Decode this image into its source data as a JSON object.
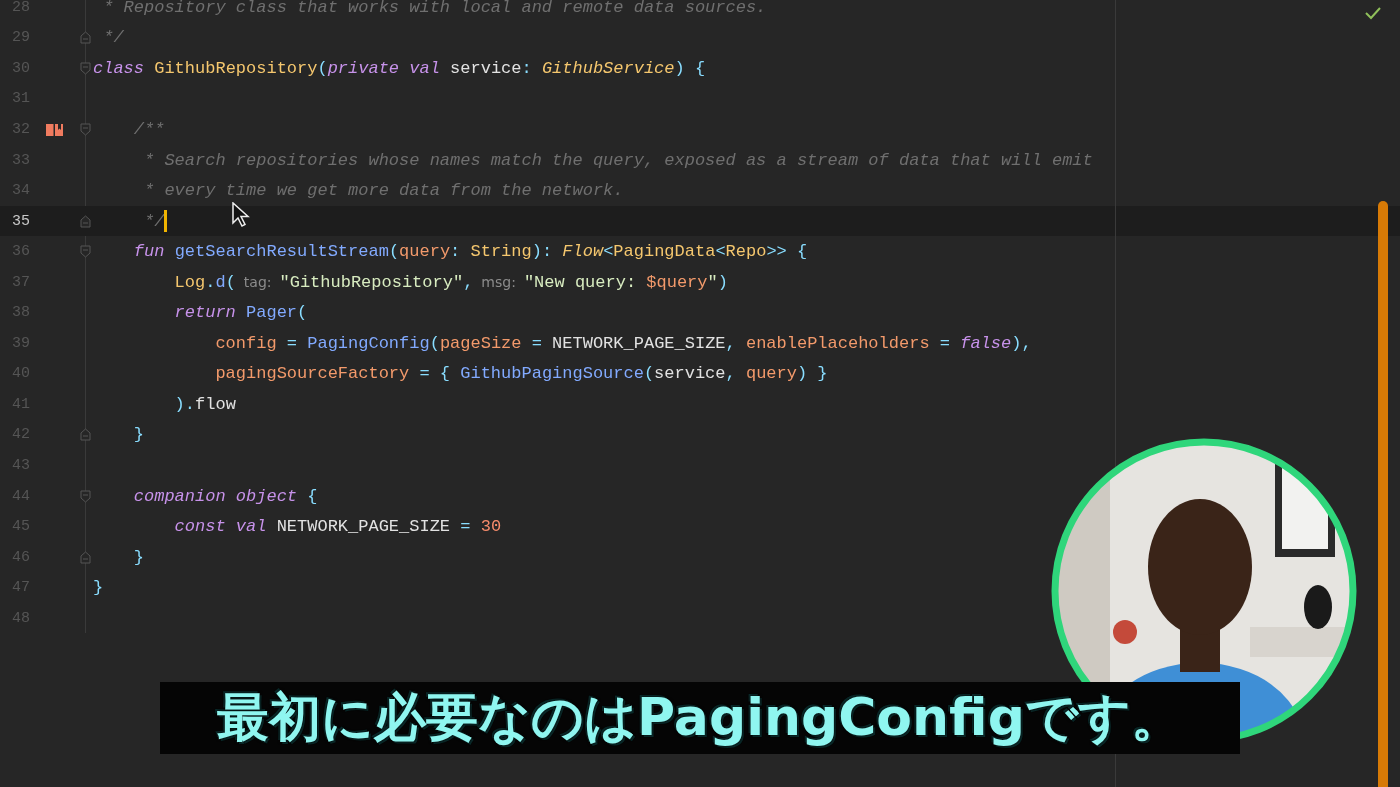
{
  "editor": {
    "lines": [
      {
        "number": "28",
        "current": false,
        "bookmarked": false,
        "fold_open": false,
        "fold_close": false,
        "caret": false,
        "tokens": [
          {
            "kind": "comment",
            "text": " * Repository class that works with local and remote data sources."
          }
        ]
      },
      {
        "number": "29",
        "current": false,
        "bookmarked": false,
        "fold_open": false,
        "fold_close": true,
        "caret": false,
        "tokens": [
          {
            "kind": "comment",
            "text": " */"
          }
        ]
      },
      {
        "number": "30",
        "current": false,
        "bookmarked": false,
        "fold_open": true,
        "fold_close": false,
        "caret": false,
        "tokens": [
          {
            "kind": "kw",
            "text": "class "
          },
          {
            "kind": "type",
            "text": "GithubRepository"
          },
          {
            "kind": "punc",
            "text": "("
          },
          {
            "kind": "kw",
            "text": "private val"
          },
          {
            "kind": "plain",
            "text": " service"
          },
          {
            "kind": "punc",
            "text": ": "
          },
          {
            "kind": "typeit",
            "text": "GithubService"
          },
          {
            "kind": "punc",
            "text": ") {"
          }
        ]
      },
      {
        "number": "31",
        "current": false,
        "bookmarked": false,
        "fold_open": false,
        "fold_close": false,
        "caret": false
      },
      {
        "number": "32",
        "current": false,
        "bookmarked": true,
        "fold_open": true,
        "fold_close": false,
        "caret": false,
        "tokens": [
          {
            "kind": "comment",
            "text": "    /**"
          }
        ]
      },
      {
        "number": "33",
        "current": false,
        "bookmarked": false,
        "fold_open": false,
        "fold_close": false,
        "caret": false,
        "tokens": [
          {
            "kind": "comment",
            "text": "     * Search repositories whose names match the query, exposed as a stream of data that will emit"
          }
        ]
      },
      {
        "number": "34",
        "current": false,
        "bookmarked": false,
        "fold_open": false,
        "fold_close": false,
        "caret": false,
        "tokens": [
          {
            "kind": "comment",
            "text": "     * every time we get more data from the network."
          }
        ]
      },
      {
        "number": "35",
        "current": true,
        "bookmarked": false,
        "fold_open": false,
        "fold_close": true,
        "caret": true,
        "tokens": [
          {
            "kind": "comment",
            "text": "     */"
          }
        ]
      },
      {
        "number": "36",
        "current": false,
        "bookmarked": false,
        "fold_open": true,
        "fold_close": false,
        "caret": false,
        "tokens": [
          {
            "kind": "kw",
            "text": "    fun "
          },
          {
            "kind": "fn",
            "text": "getSearchResultStream"
          },
          {
            "kind": "punc",
            "text": "("
          },
          {
            "kind": "param",
            "text": "query"
          },
          {
            "kind": "punc",
            "text": ": "
          },
          {
            "kind": "type",
            "text": "String"
          },
          {
            "kind": "punc",
            "text": "): "
          },
          {
            "kind": "typeit",
            "text": "Flow"
          },
          {
            "kind": "punc",
            "text": "<"
          },
          {
            "kind": "type",
            "text": "PagingData"
          },
          {
            "kind": "punc",
            "text": "<"
          },
          {
            "kind": "type",
            "text": "Repo"
          },
          {
            "kind": "punc",
            "text": ">> {"
          }
        ]
      },
      {
        "number": "37",
        "current": false,
        "bookmarked": false,
        "fold_open": false,
        "fold_close": false,
        "caret": false,
        "tokens": [
          {
            "kind": "type",
            "text": "        Log"
          },
          {
            "kind": "punc",
            "text": "."
          },
          {
            "kind": "fn",
            "text": "d"
          },
          {
            "kind": "punc",
            "text": "("
          },
          {
            "kind": "hint",
            "text": "tag:"
          },
          {
            "kind": "str",
            "text": "\"GithubRepository\""
          },
          {
            "kind": "punc",
            "text": ","
          },
          {
            "kind": "hint",
            "text": "msg:"
          },
          {
            "kind": "str",
            "text": "\"New query: "
          },
          {
            "kind": "param",
            "text": "$query"
          },
          {
            "kind": "str",
            "text": "\""
          },
          {
            "kind": "punc",
            "text": ")"
          }
        ]
      },
      {
        "number": "38",
        "current": false,
        "bookmarked": false,
        "fold_open": false,
        "fold_close": false,
        "caret": false,
        "tokens": [
          {
            "kind": "kw",
            "text": "        return "
          },
          {
            "kind": "fn",
            "text": "Pager"
          },
          {
            "kind": "punc",
            "text": "("
          }
        ]
      },
      {
        "number": "39",
        "current": false,
        "bookmarked": false,
        "fold_open": false,
        "fold_close": false,
        "caret": false,
        "tokens": [
          {
            "kind": "param",
            "text": "            config "
          },
          {
            "kind": "punc",
            "text": "= "
          },
          {
            "kind": "fn",
            "text": "PagingConfig"
          },
          {
            "kind": "punc",
            "text": "("
          },
          {
            "kind": "param",
            "text": "pageSize "
          },
          {
            "kind": "punc",
            "text": "= "
          },
          {
            "kind": "plain",
            "text": "NETWORK_PAGE_SIZE"
          },
          {
            "kind": "punc",
            "text": ", "
          },
          {
            "kind": "param",
            "text": "enablePlaceholders "
          },
          {
            "kind": "punc",
            "text": "= "
          },
          {
            "kind": "kw",
            "text": "false"
          },
          {
            "kind": "punc",
            "text": "),"
          }
        ]
      },
      {
        "number": "40",
        "current": false,
        "bookmarked": false,
        "fold_open": false,
        "fold_close": false,
        "caret": false,
        "tokens": [
          {
            "kind": "param",
            "text": "            pagingSourceFactory "
          },
          {
            "kind": "punc",
            "text": "= { "
          },
          {
            "kind": "fn",
            "text": "GithubPagingSource"
          },
          {
            "kind": "punc",
            "text": "("
          },
          {
            "kind": "plain",
            "text": "service"
          },
          {
            "kind": "punc",
            "text": ", "
          },
          {
            "kind": "param",
            "text": "query"
          },
          {
            "kind": "punc",
            "text": ") }"
          }
        ]
      },
      {
        "number": "41",
        "current": false,
        "bookmarked": false,
        "fold_open": false,
        "fold_close": false,
        "caret": false,
        "tokens": [
          {
            "kind": "punc",
            "text": "        )."
          },
          {
            "kind": "plain",
            "text": "flow"
          }
        ]
      },
      {
        "number": "42",
        "current": false,
        "bookmarked": false,
        "fold_open": false,
        "fold_close": true,
        "caret": false,
        "tokens": [
          {
            "kind": "punc",
            "text": "    }"
          }
        ]
      },
      {
        "number": "43",
        "current": false,
        "bookmarked": false,
        "fold_open": false,
        "fold_close": false,
        "caret": false
      },
      {
        "number": "44",
        "current": false,
        "bookmarked": false,
        "fold_open": true,
        "fold_close": false,
        "caret": false,
        "tokens": [
          {
            "kind": "kw",
            "text": "    companion object"
          },
          {
            "kind": "punc",
            "text": " {"
          }
        ]
      },
      {
        "number": "45",
        "current": false,
        "bookmarked": false,
        "fold_open": false,
        "fold_close": false,
        "caret": false,
        "tokens": [
          {
            "kind": "kw",
            "text": "        const val"
          },
          {
            "kind": "plain",
            "text": " NETWORK_PAGE_SIZE "
          },
          {
            "kind": "punc",
            "text": "= "
          },
          {
            "kind": "num",
            "text": "30"
          }
        ]
      },
      {
        "number": "46",
        "current": false,
        "bookmarked": false,
        "fold_open": false,
        "fold_close": true,
        "caret": false,
        "tokens": [
          {
            "kind": "punc",
            "text": "    }"
          }
        ]
      },
      {
        "number": "47",
        "current": false,
        "bookmarked": false,
        "fold_open": false,
        "fold_close": false,
        "caret": false,
        "tokens": [
          {
            "kind": "punc",
            "text": "}"
          }
        ]
      },
      {
        "number": "48",
        "current": false,
        "bookmarked": false,
        "fold_open": false,
        "fold_close": false,
        "caret": false
      }
    ]
  },
  "subtitle": {
    "text": "最初に必要なのはPagingConfigです。"
  }
}
